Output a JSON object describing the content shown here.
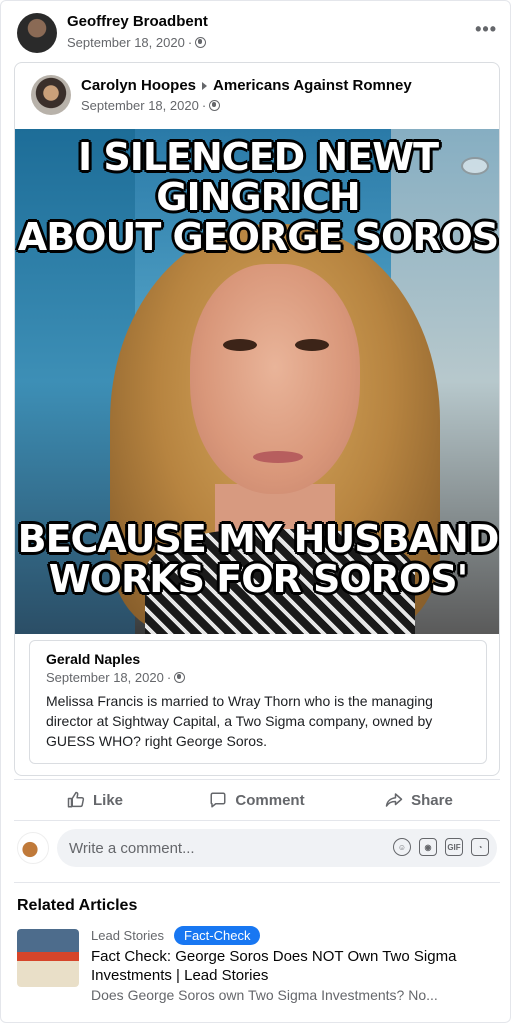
{
  "post": {
    "author": "Geoffrey Broadbent",
    "date": "September 18, 2020",
    "more_label": "•••"
  },
  "shared": {
    "author": "Carolyn Hoopes",
    "group": "Americans Against Romney",
    "date": "September 18, 2020"
  },
  "meme": {
    "top_line1": "I SILENCED NEWT GINGRICH",
    "top_line2": "ABOUT GEORGE SOROS",
    "bottom_line1": "BECAUSE MY HUSBAND",
    "bottom_line2": "WORKS FOR SOROS'"
  },
  "caption": {
    "author": "Gerald Naples",
    "date": "September 18, 2020",
    "text": "Melissa Francis is married to Wray Thorn who is the managing director at Sightway Capital, a Two Sigma company, owned by GUESS WHO? right George Soros."
  },
  "actions": {
    "like": "Like",
    "comment": "Comment",
    "share": "Share"
  },
  "comment_box": {
    "placeholder": "Write a comment..."
  },
  "related": {
    "title": "Related Articles",
    "source": "Lead Stories",
    "badge": "Fact-Check",
    "headline": "Fact Check: George Soros Does NOT Own Two Sigma Investments | Lead Stories",
    "description": "Does George Soros own Two Sigma Investments? No..."
  }
}
